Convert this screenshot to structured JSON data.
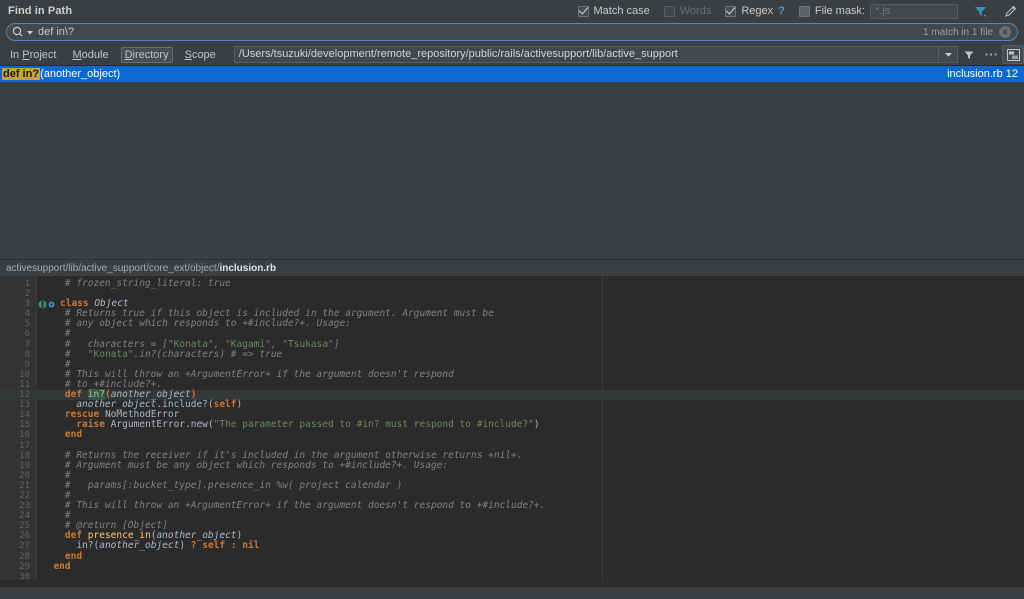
{
  "window": {
    "title": "Find in Path"
  },
  "options": {
    "match_case": {
      "label": "Match case",
      "checked": true
    },
    "words": {
      "label": "Words",
      "checked": false,
      "disabled": true
    },
    "regex": {
      "label": "Regex",
      "suffix": "?",
      "checked": true
    },
    "file_mask": {
      "label": "File mask:",
      "checked": false,
      "value": "*.js"
    },
    "filter_icon": "filter-icon",
    "pin_icon": "pin-icon"
  },
  "search": {
    "icon": "search-icon",
    "dropdown_icon": "chevron-down-icon",
    "value": "def in\\?",
    "match_count": "1 match in 1 file",
    "clear_icon": "close-icon",
    "clear_label": "×"
  },
  "scope": {
    "tabs": [
      {
        "label_pre": "In ",
        "mnemonic": "P",
        "label_post": "roject",
        "active": false,
        "name": "scope-tab-in-project"
      },
      {
        "label_pre": "",
        "mnemonic": "M",
        "label_post": "odule",
        "active": false,
        "name": "scope-tab-module"
      },
      {
        "label_pre": "",
        "mnemonic": "D",
        "label_post": "irectory",
        "active": true,
        "name": "scope-tab-directory"
      },
      {
        "label_pre": "",
        "mnemonic": "S",
        "label_post": "cope",
        "active": false,
        "name": "scope-tab-scope"
      }
    ],
    "path": "/Users/tsuzuki/development/remote_repository/public/rails/activesupport/lib/active_support",
    "path_dropdown_icon": "chevron-down-icon",
    "recursive_icon": "filter-funnel-icon",
    "more_icon": "ellipsis-icon",
    "preview_icon": "preview-panel-icon"
  },
  "results": {
    "rows": [
      {
        "match_text": "def in?",
        "rest_text": "(another_object)",
        "location": "inclusion.rb  12",
        "selected": true
      }
    ]
  },
  "breadcrumb": {
    "path_prefix": "activesupport/lib/active_support/core_ext/object/",
    "file": "inclusion.rb"
  },
  "editor": {
    "lines": [
      {
        "n": "1",
        "tokens": [
          {
            "t": "    ",
            "c": "c-plain"
          },
          {
            "t": "# frozen_string_literal: true",
            "c": "c-com"
          }
        ]
      },
      {
        "n": "2",
        "tokens": []
      },
      {
        "n": "3",
        "tokens": [
          {
            "t": "class ",
            "c": "c-kw"
          },
          {
            "t": "Object",
            "c": "c-cls"
          }
        ],
        "marker": true
      },
      {
        "n": "4",
        "tokens": [
          {
            "t": "    ",
            "c": "c-plain"
          },
          {
            "t": "# Returns true if this object is included in the argument. Argument must be",
            "c": "c-com"
          }
        ]
      },
      {
        "n": "5",
        "tokens": [
          {
            "t": "    ",
            "c": "c-plain"
          },
          {
            "t": "# any object which responds to +#include?+. Usage:",
            "c": "c-com"
          }
        ]
      },
      {
        "n": "6",
        "tokens": [
          {
            "t": "    ",
            "c": "c-plain"
          },
          {
            "t": "#",
            "c": "c-com"
          }
        ]
      },
      {
        "n": "7",
        "tokens": [
          {
            "t": "    ",
            "c": "c-plain"
          },
          {
            "t": "#   characters = [",
            "c": "c-com"
          },
          {
            "t": "\"Konata\"",
            "c": "c-str"
          },
          {
            "t": ", ",
            "c": "c-com"
          },
          {
            "t": "\"Kagami\"",
            "c": "c-str"
          },
          {
            "t": ", ",
            "c": "c-com"
          },
          {
            "t": "\"Tsukasa\"",
            "c": "c-str"
          },
          {
            "t": "]",
            "c": "c-com"
          }
        ]
      },
      {
        "n": "8",
        "tokens": [
          {
            "t": "    ",
            "c": "c-plain"
          },
          {
            "t": "#   ",
            "c": "c-com"
          },
          {
            "t": "\"Konata\"",
            "c": "c-str"
          },
          {
            "t": ".in?(characters) # => true",
            "c": "c-com"
          }
        ]
      },
      {
        "n": "9",
        "tokens": [
          {
            "t": "    ",
            "c": "c-plain"
          },
          {
            "t": "#",
            "c": "c-com"
          }
        ]
      },
      {
        "n": "10",
        "tokens": [
          {
            "t": "    ",
            "c": "c-plain"
          },
          {
            "t": "# This will throw an +ArgumentError+ if the argument doesn't respond",
            "c": "c-com"
          }
        ]
      },
      {
        "n": "11",
        "tokens": [
          {
            "t": "    ",
            "c": "c-plain"
          },
          {
            "t": "# to +#include?+.",
            "c": "c-com"
          }
        ]
      },
      {
        "n": "12",
        "highlight": true,
        "tokens": [
          {
            "t": "    ",
            "c": "c-plain"
          },
          {
            "t": "def ",
            "c": "c-kw"
          },
          {
            "t": "in?",
            "c": "c-hl"
          },
          {
            "t": "(",
            "c": "c-kw"
          },
          {
            "t": "another_object",
            "c": "c-param"
          },
          {
            "t": ")",
            "c": "c-kw"
          }
        ]
      },
      {
        "n": "13",
        "tokens": [
          {
            "t": "      ",
            "c": "c-plain"
          },
          {
            "t": "another_object",
            "c": "c-param"
          },
          {
            "t": ".include?(",
            "c": "c-plain"
          },
          {
            "t": "self",
            "c": "c-kw"
          },
          {
            "t": ")",
            "c": "c-plain"
          }
        ]
      },
      {
        "n": "14",
        "tokens": [
          {
            "t": "    ",
            "c": "c-plain"
          },
          {
            "t": "rescue ",
            "c": "c-kw"
          },
          {
            "t": "NoMethodError",
            "c": "c-plain"
          }
        ]
      },
      {
        "n": "15",
        "tokens": [
          {
            "t": "      ",
            "c": "c-plain"
          },
          {
            "t": "raise ",
            "c": "c-kw"
          },
          {
            "t": "ArgumentError",
            "c": "c-plain"
          },
          {
            "t": ".new(",
            "c": "c-plain"
          },
          {
            "t": "\"The parameter passed to #in? must respond to #include?\"",
            "c": "c-str"
          },
          {
            "t": ")",
            "c": "c-plain"
          }
        ]
      },
      {
        "n": "16",
        "tokens": [
          {
            "t": "    ",
            "c": "c-plain"
          },
          {
            "t": "end",
            "c": "c-kw"
          }
        ]
      },
      {
        "n": "17",
        "tokens": []
      },
      {
        "n": "18",
        "tokens": [
          {
            "t": "    ",
            "c": "c-plain"
          },
          {
            "t": "# Returns the receiver if it's included in the argument otherwise returns +nil+.",
            "c": "c-com"
          }
        ]
      },
      {
        "n": "19",
        "tokens": [
          {
            "t": "    ",
            "c": "c-plain"
          },
          {
            "t": "# Argument must be any object which responds to +#include?+. Usage:",
            "c": "c-com"
          }
        ]
      },
      {
        "n": "20",
        "tokens": [
          {
            "t": "    ",
            "c": "c-plain"
          },
          {
            "t": "#",
            "c": "c-com"
          }
        ]
      },
      {
        "n": "21",
        "tokens": [
          {
            "t": "    ",
            "c": "c-plain"
          },
          {
            "t": "#   params[:bucket_type].presence_in %w( project calendar )",
            "c": "c-com"
          }
        ]
      },
      {
        "n": "22",
        "tokens": [
          {
            "t": "    ",
            "c": "c-plain"
          },
          {
            "t": "#",
            "c": "c-com"
          }
        ]
      },
      {
        "n": "23",
        "tokens": [
          {
            "t": "    ",
            "c": "c-plain"
          },
          {
            "t": "# This will throw an +ArgumentError+ if the argument doesn't respond to +#include?+.",
            "c": "c-com"
          }
        ]
      },
      {
        "n": "24",
        "tokens": [
          {
            "t": "    ",
            "c": "c-plain"
          },
          {
            "t": "#",
            "c": "c-com"
          }
        ]
      },
      {
        "n": "25",
        "tokens": [
          {
            "t": "    ",
            "c": "c-plain"
          },
          {
            "t": "# @return [Object]",
            "c": "c-com"
          }
        ]
      },
      {
        "n": "26",
        "tokens": [
          {
            "t": "    ",
            "c": "c-plain"
          },
          {
            "t": "def ",
            "c": "c-kw"
          },
          {
            "t": "presence_in",
            "c": "c-mth"
          },
          {
            "t": "(",
            "c": "c-plain"
          },
          {
            "t": "another_object",
            "c": "c-param"
          },
          {
            "t": ")",
            "c": "c-plain"
          }
        ]
      },
      {
        "n": "27",
        "tokens": [
          {
            "t": "      ",
            "c": "c-plain"
          },
          {
            "t": "in?",
            "c": "c-plain"
          },
          {
            "t": "(",
            "c": "c-plain"
          },
          {
            "t": "another_object",
            "c": "c-param"
          },
          {
            "t": ") ",
            "c": "c-plain"
          },
          {
            "t": "? ",
            "c": "c-kw"
          },
          {
            "t": "self",
            "c": "c-kw"
          },
          {
            "t": " : ",
            "c": "c-kw"
          },
          {
            "t": "nil",
            "c": "c-kw"
          }
        ]
      },
      {
        "n": "28",
        "tokens": [
          {
            "t": "    ",
            "c": "c-plain"
          },
          {
            "t": "end",
            "c": "c-kw"
          }
        ]
      },
      {
        "n": "29",
        "tokens": [
          {
            "t": "  ",
            "c": "c-plain"
          },
          {
            "t": "end",
            "c": "c-kw"
          }
        ]
      },
      {
        "n": "30",
        "tokens": []
      }
    ]
  }
}
